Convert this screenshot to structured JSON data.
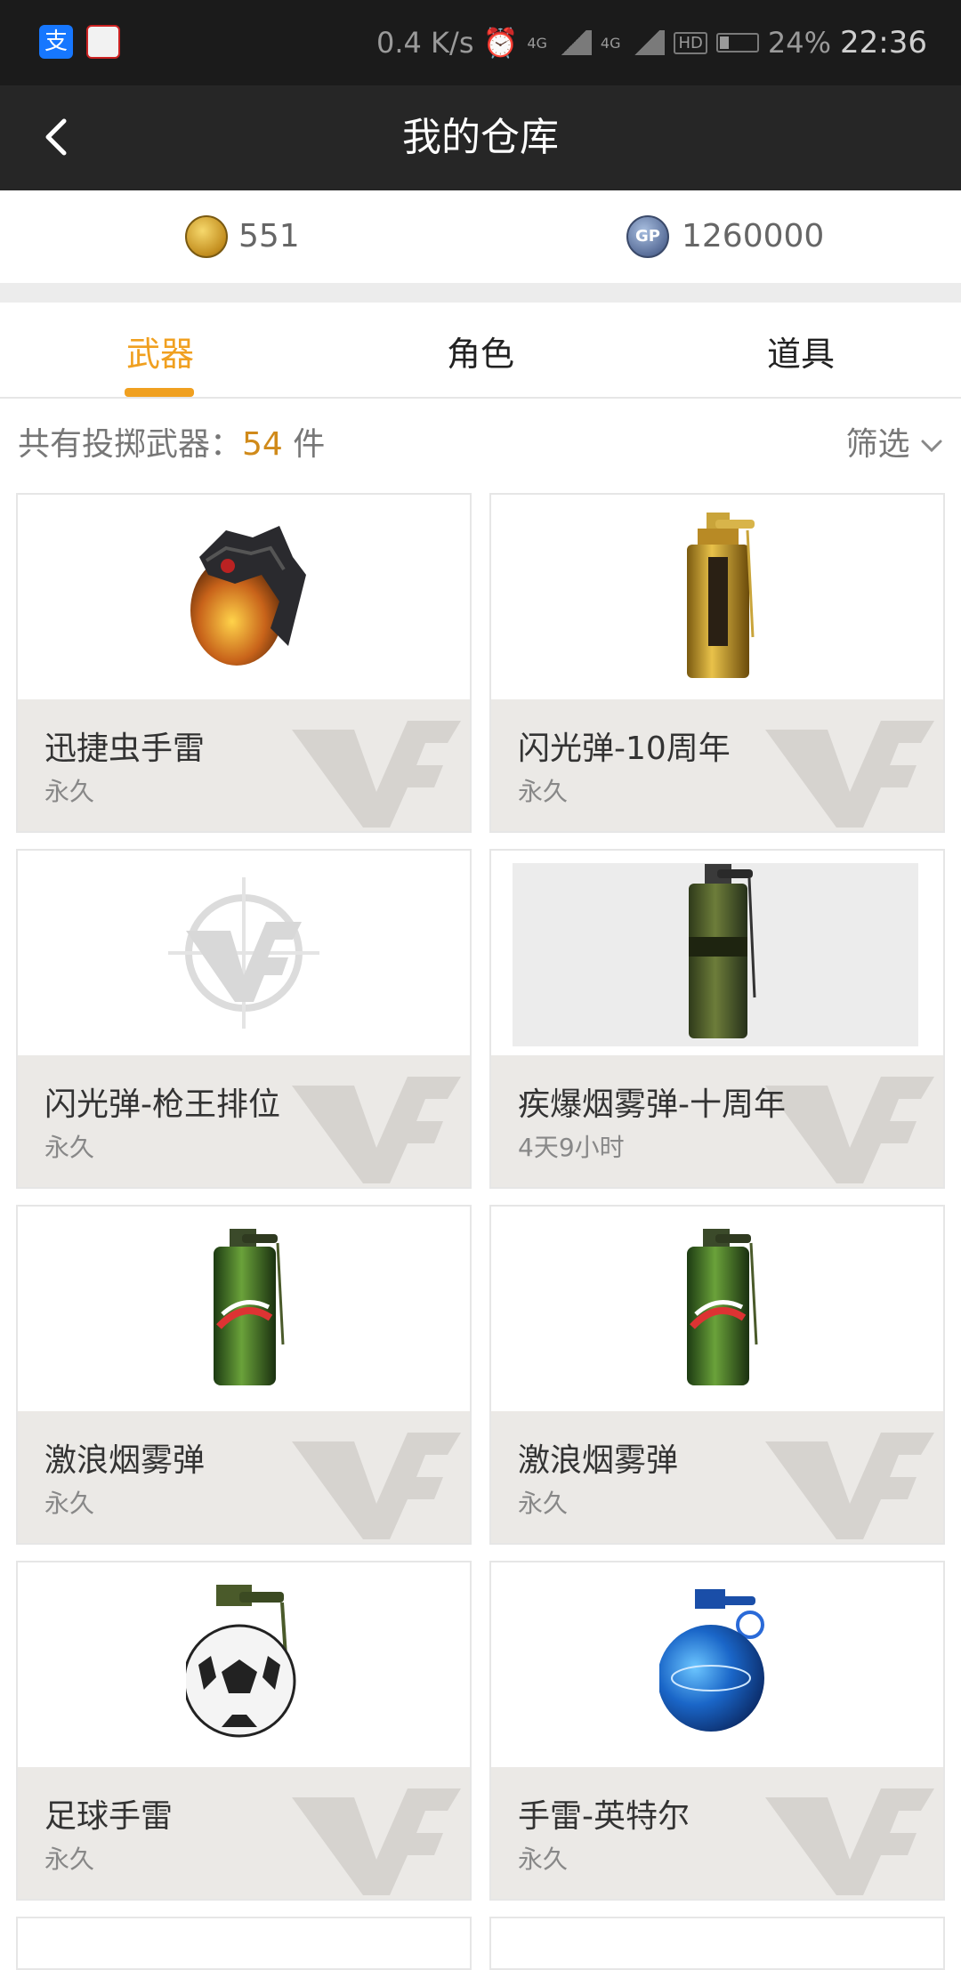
{
  "status_bar": {
    "speed": "0.4 K/s",
    "net1": "4G",
    "net2": "4G",
    "hd": "HD",
    "battery": "24%",
    "time": "22:36",
    "alipay_glyph": "支"
  },
  "header": {
    "title": "我的仓库"
  },
  "currency": {
    "cf_points": "551",
    "gp_label": "GP",
    "gp_points": "1260000"
  },
  "tabs": [
    {
      "label": "武器",
      "active": true
    },
    {
      "label": "角色",
      "active": false
    },
    {
      "label": "道具",
      "active": false
    }
  ],
  "summary": {
    "prefix": "共有投掷武器：",
    "count": "54",
    "suffix": " 件"
  },
  "filter": {
    "label": "筛选"
  },
  "items": [
    {
      "name": "迅捷虫手雷",
      "duration": "永久",
      "icon": "bug-grenade-icon"
    },
    {
      "name": "闪光弹-10周年",
      "duration": "永久",
      "icon": "gold-flash-grenade-icon"
    },
    {
      "name": "闪光弹-枪王排位",
      "duration": "永久",
      "icon": "cf-placeholder-icon"
    },
    {
      "name": "疾爆烟雾弹-十周年",
      "duration": "4天9小时",
      "icon": "green-smoke-grenade-icon"
    },
    {
      "name": "激浪烟雾弹",
      "duration": "永久",
      "icon": "mountain-dew-grenade-icon"
    },
    {
      "name": "激浪烟雾弹",
      "duration": "永久",
      "icon": "mountain-dew-grenade-icon"
    },
    {
      "name": "足球手雷",
      "duration": "永久",
      "icon": "football-grenade-icon"
    },
    {
      "name": "手雷-英特尔",
      "duration": "永久",
      "icon": "intel-grenade-icon"
    }
  ],
  "colors": {
    "accent": "#f0a020",
    "header_bg": "#262626",
    "info_bg": "#ebe9e6"
  }
}
